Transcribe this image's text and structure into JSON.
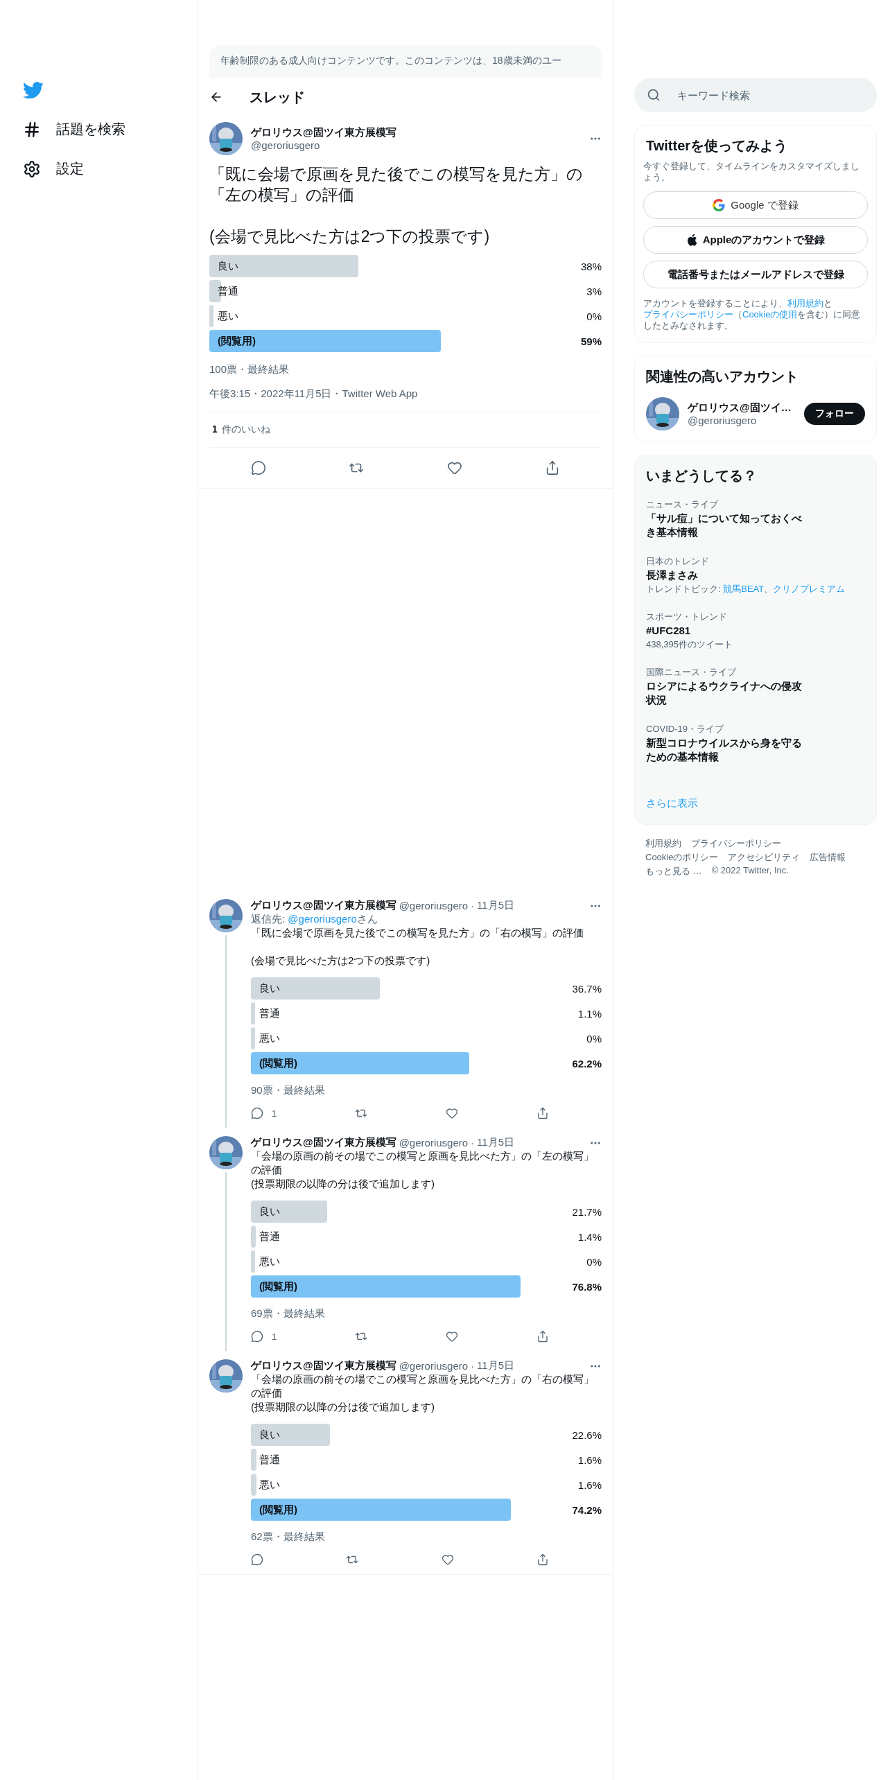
{
  "nav": {
    "items": [
      {
        "label": "話題を検索"
      },
      {
        "label": "設定"
      }
    ]
  },
  "notice": "年齢制限のある成人向けコンテンツです。このコンテンツは、18歳未満のユー",
  "header": {
    "title": "スレッド"
  },
  "main_tweet": {
    "name": "ゲロリウス@固ツイ東方展模写",
    "handle": "@geroriusgero",
    "text": "「既に会場で原画を見た後でこの模写を見た方」の「左の模写」の評価\n\n(会場で見比べた方は2つ下の投票です)",
    "poll": [
      {
        "label": "良い",
        "percent": "38%",
        "leading": false
      },
      {
        "label": "普通",
        "percent": "3%",
        "leading": false
      },
      {
        "label": "悪い",
        "percent": "0%",
        "leading": false
      },
      {
        "label": "(閲覧用)",
        "percent": "59%",
        "leading": true
      }
    ],
    "votes": "100票・最終結果",
    "timestamp": "午後3:15・2022年11月5日・Twitter Web App",
    "likes": {
      "count": "1",
      "label": "件のいいね"
    }
  },
  "replies": [
    {
      "name": "ゲロリウス@固ツイ東方展模写",
      "handle": "@geroriusgero",
      "separator": "·",
      "date": "11月5日",
      "reply_to": {
        "prefix": "返信先: ",
        "handle": "@geroriusgero",
        "suffix": "さん"
      },
      "text": "「既に会場で原画を見た後でこの模写を見た方」の「右の模写」の評価\n\n(会場で見比べた方は2つ下の投票です)",
      "thread": true,
      "poll": [
        {
          "label": "良い",
          "percent": "36.7%",
          "leading": false
        },
        {
          "label": "普通",
          "percent": "1.1%",
          "leading": false
        },
        {
          "label": "悪い",
          "percent": "0%",
          "leading": false
        },
        {
          "label": "(閲覧用)",
          "percent": "62.2%",
          "leading": true
        }
      ],
      "votes": "90票・最終結果",
      "reply_count": "1"
    },
    {
      "name": "ゲロリウス@固ツイ東方展模写",
      "handle": "@geroriusgero",
      "separator": "·",
      "date": "11月5日",
      "text": "「会場の原画の前その場でこの模写と原画を見比べた方」の「左の模写」の評価\n(投票期限の以降の分は後で追加します)",
      "thread": true,
      "poll": [
        {
          "label": "良い",
          "percent": "21.7%",
          "leading": false
        },
        {
          "label": "普通",
          "percent": "1.4%",
          "leading": false
        },
        {
          "label": "悪い",
          "percent": "0%",
          "leading": false
        },
        {
          "label": "(閲覧用)",
          "percent": "76.8%",
          "leading": true
        }
      ],
      "votes": "69票・最終結果",
      "reply_count": "1"
    },
    {
      "name": "ゲロリウス@固ツイ東方展模写",
      "handle": "@geroriusgero",
      "separator": "·",
      "date": "11月5日",
      "text": "「会場の原画の前その場でこの模写と原画を見比べた方」の「右の模写」の評価\n(投票期限の以降の分は後で追加します)",
      "thread": false,
      "poll": [
        {
          "label": "良い",
          "percent": "22.6%",
          "leading": false
        },
        {
          "label": "普通",
          "percent": "1.6%",
          "leading": false
        },
        {
          "label": "悪い",
          "percent": "1.6%",
          "leading": false
        },
        {
          "label": "(閲覧用)",
          "percent": "74.2%",
          "leading": true
        }
      ],
      "votes": "62票・最終結果"
    }
  ],
  "search": {
    "placeholder": "キーワード検索"
  },
  "signup": {
    "title": "Twitterを使ってみよう",
    "subtitle": "今すぐ登録して、タイムラインをカスタマイズしましょう。",
    "buttons": [
      {
        "kind": "google",
        "label": "Google で登録"
      },
      {
        "kind": "apple",
        "label": "Appleのアカウントで登録"
      },
      {
        "kind": "plain",
        "label": "電話番号またはメールアドレスで登録"
      }
    ],
    "legal": [
      {
        "kind": "text",
        "text": "アカウントを登録することにより、"
      },
      {
        "kind": "link",
        "text": "利用規約"
      },
      {
        "kind": "text",
        "text": "と"
      },
      {
        "kind": "link",
        "text": "プライバシーポリシー"
      },
      {
        "kind": "text",
        "text": "（"
      },
      {
        "kind": "link",
        "text": "Cookieの使用"
      },
      {
        "kind": "text",
        "text": "を含む）に同意したとみなされます。"
      }
    ]
  },
  "related": {
    "title": "関連性の高いアカウント",
    "account": {
      "name": "ゲロリウス@固ツイ…",
      "handle": "@geroriusgero",
      "button": "フォロー"
    }
  },
  "trends": {
    "title": "いまどうしてる？",
    "items": [
      {
        "category": "ニュース・ライブ",
        "title": "「サル痘」について知っておくべき基本情報"
      },
      {
        "category": "日本のトレンド",
        "title": "長澤まさみ",
        "meta": [
          {
            "kind": "text",
            "text": "トレンドトピック: "
          },
          {
            "kind": "link",
            "text": "競馬BEAT"
          },
          {
            "kind": "text",
            "text": "、"
          },
          {
            "kind": "link",
            "text": "クリノプレミアム"
          }
        ]
      },
      {
        "category": "スポーツ・トレンド",
        "title": "#UFC281",
        "meta": [
          {
            "kind": "text",
            "text": "438,395件のツイート"
          }
        ]
      },
      {
        "category": "国際ニュース・ライブ",
        "title": "ロシアによるウクライナへの侵攻状況"
      },
      {
        "category": "COVID-19・ライブ",
        "title": "新型コロナウイルスから身を守るための基本情報"
      }
    ],
    "more": "さらに表示"
  },
  "footer": [
    "利用規約",
    "プライバシーポリシー",
    "Cookieのポリシー",
    "アクセシビリティ",
    "広告情報",
    "もっと見る …",
    "© 2022 Twitter, Inc."
  ]
}
